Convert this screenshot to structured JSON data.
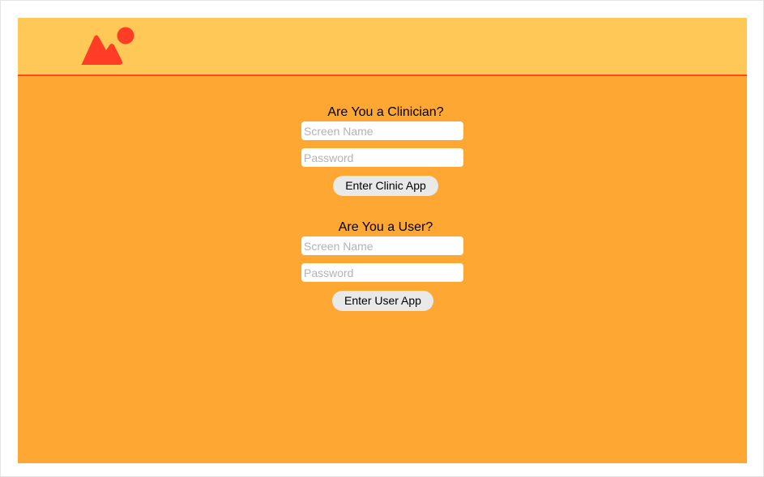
{
  "header": {
    "logo_icon": "mountain-sun-icon",
    "logo_color": "#ff3d26",
    "background": "#ffc857",
    "border_color": "#ff4a1f"
  },
  "main": {
    "background": "#ffa733"
  },
  "clinician": {
    "title": "Are You a Clinician?",
    "screen_name_placeholder": "Screen Name",
    "password_placeholder": "Password",
    "button_label": "Enter Clinic App"
  },
  "user": {
    "title": "Are You a User?",
    "screen_name_placeholder": "Screen Name",
    "password_placeholder": "Password",
    "button_label": "Enter User App"
  }
}
